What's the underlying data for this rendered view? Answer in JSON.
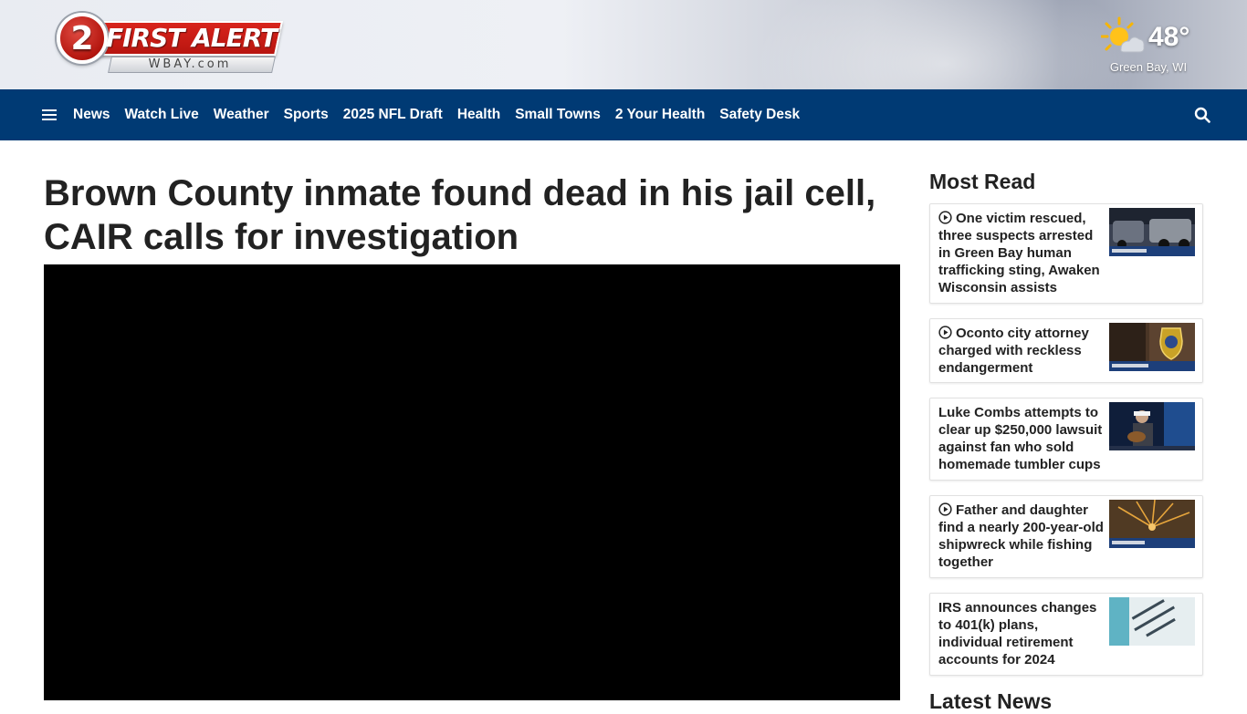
{
  "header": {
    "logo_number": "2",
    "logo_text": "FIRST ALERT",
    "logo_subtext": "WBAY.com",
    "weather": {
      "temp": "48°",
      "location": "Green Bay, WI",
      "icon": "partly-sunny-icon"
    }
  },
  "nav": {
    "items": [
      "News",
      "Watch Live",
      "Weather",
      "Sports",
      "2025 NFL Draft",
      "Health",
      "Small Towns",
      "2 Your Health",
      "Safety Desk"
    ],
    "menu_icon": "hamburger-menu-icon",
    "search_icon": "search-icon",
    "background": "#003a74"
  },
  "article": {
    "headline": "Brown County inmate found dead in his jail cell, CAIR calls for investigation"
  },
  "sidebar": {
    "title": "Most Read",
    "next_title": "Latest News",
    "items": [
      {
        "title": "One victim rescued, three suspects arrested in Green Bay human trafficking sting, Awaken Wisconsin assists",
        "video": true
      },
      {
        "title": "Oconto city attorney charged with reckless endangerment",
        "video": true
      },
      {
        "title": "Luke Combs attempts to clear up $250,000 lawsuit against fan who sold homemade tumbler cups",
        "video": false
      },
      {
        "title": "Father and daughter find a nearly 200-year-old shipwreck while fishing together",
        "video": true
      },
      {
        "title": "IRS announces changes to 401(k) plans, individual retirement accounts for 2024",
        "video": false
      }
    ]
  }
}
